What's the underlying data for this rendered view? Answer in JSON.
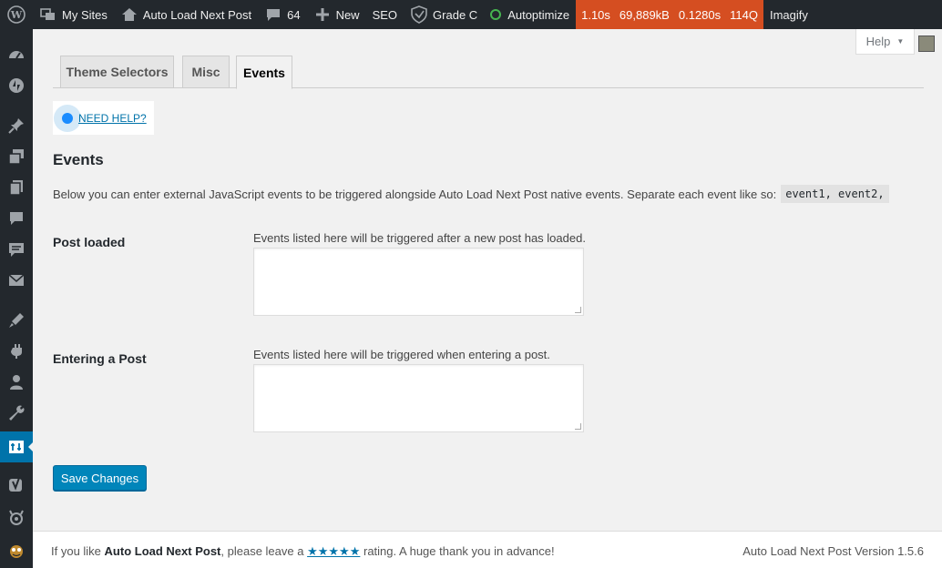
{
  "adminbar": {
    "my_sites": "My Sites",
    "site_name": "Auto Load Next Post",
    "comments_count": "64",
    "new_label": "New",
    "seo_label": "SEO",
    "grade_label": "Grade C",
    "autoptimize_label": "Autoptimize",
    "perf": {
      "time": "1.10s",
      "memory": "69,889kB",
      "query_time": "0.1280s",
      "queries": "114Q"
    },
    "imagify_label": "Imagify",
    "perf_color": "#d54e21",
    "autoptimize_status_color": "#46b450"
  },
  "sidebar": {
    "icons": [
      "dashboard-icon",
      "jetpack-icon",
      "pin-icon",
      "media-icon",
      "pages-icon",
      "comments-icon",
      "feedback-icon",
      "mail-icon",
      "appearance-icon",
      "plugins-icon",
      "users-icon",
      "tools-icon",
      "settings-icon",
      "yoast-icon",
      "security-icon",
      "imagify-icon"
    ],
    "active": "settings-icon"
  },
  "help_tab": {
    "label": "Help"
  },
  "tabs": [
    {
      "label": "Theme Selectors",
      "active": false
    },
    {
      "label": "Misc",
      "active": false
    },
    {
      "label": "Events",
      "active": true
    }
  ],
  "need_help": {
    "label": "NEED HELP?"
  },
  "section": {
    "title": "Events",
    "intro": "Below you can enter external JavaScript events to be triggered alongside Auto Load Next Post native events. Separate each event like so:",
    "example_code": "event1, event2,"
  },
  "fields": [
    {
      "label": "Post loaded",
      "description": "Events listed here will be triggered after a new post has loaded.",
      "value": ""
    },
    {
      "label": "Entering a Post",
      "description": "Events listed here will be triggered when entering a post.",
      "value": ""
    }
  ],
  "save_button": "Save Changes",
  "footer": {
    "left_prefix": "If you like",
    "plugin_name": "Auto Load Next Post",
    "left_middle": ", please leave a",
    "stars": "★★★★★",
    "left_suffix": "rating. A huge thank you in advance!",
    "version": "Auto Load Next Post Version 1.5.6"
  },
  "colors": {
    "primary": "#0085ba",
    "adminbar": "#23282d",
    "link": "#0073aa"
  }
}
